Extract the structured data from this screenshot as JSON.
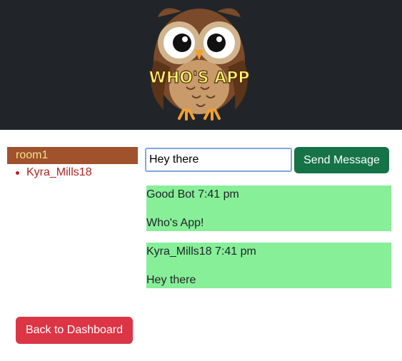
{
  "header": {
    "logo_text": "WHO'S APP",
    "logo_icon": "owl-logo-icon"
  },
  "sidebar": {
    "room_name": "room1",
    "users": [
      {
        "name": "Kyra_Mills18"
      }
    ]
  },
  "composer": {
    "input_value": "Hey there",
    "send_label": "Send Message"
  },
  "messages": [
    {
      "author": "Good Bot",
      "time": "7:41 pm",
      "text": "Who's App!"
    },
    {
      "author": "Kyra_Mills18",
      "time": "7:41 pm",
      "text": "Hey there"
    }
  ],
  "footer": {
    "back_label": "Back to Dashboard"
  },
  "colors": {
    "header_bg": "#212529",
    "room_bg": "#a0522d",
    "room_text": "#f5e08a",
    "user_text": "#b22222",
    "message_bg": "#86ef97",
    "send_bg": "#157347",
    "back_bg": "#dc3545"
  }
}
